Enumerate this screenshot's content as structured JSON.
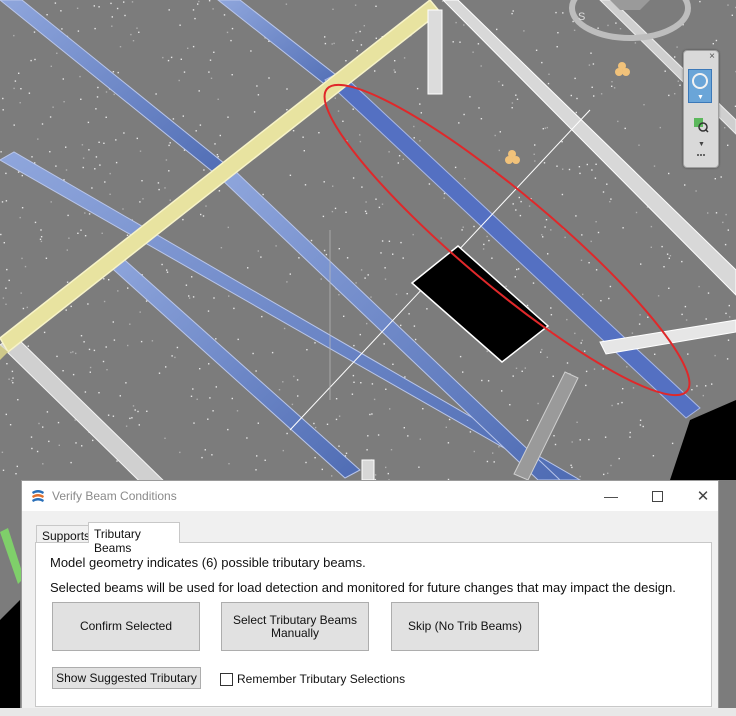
{
  "viewport": {
    "background_color": "#7c7c7c",
    "beam_color_blue": "#6a84c4",
    "beam_color_yellow": "#e8e3a0",
    "highlight_ellipse_color": "#e0282a",
    "icons": [
      "view-cube-icon",
      "light-fixture-icon",
      "navigation-wheel-icon",
      "zoom-region-icon"
    ]
  },
  "dialog": {
    "title": "Verify Beam Conditions",
    "minimize_glyph": "—",
    "close_glyph": "✕",
    "tabs": [
      {
        "label": "Supports",
        "active": false
      },
      {
        "label": "Tributary Beams",
        "active": true
      }
    ],
    "message_line1": "Model geometry indicates (6) possible tributary beams.",
    "message_line2": "Selected beams will be used for load detection and monitored for future changes that may impact the design.",
    "buttons": {
      "confirm": "Confirm Selected",
      "select_manual": "Select Tributary Beams Manually",
      "skip": "Skip (No Trib Beams)",
      "show_suggested": "Show Suggested Tributary"
    },
    "remember_checkbox": {
      "label": "Remember Tributary Selections",
      "checked": false
    }
  },
  "navbar": {
    "close_glyph": "×",
    "arrow_glyph": "▼"
  }
}
